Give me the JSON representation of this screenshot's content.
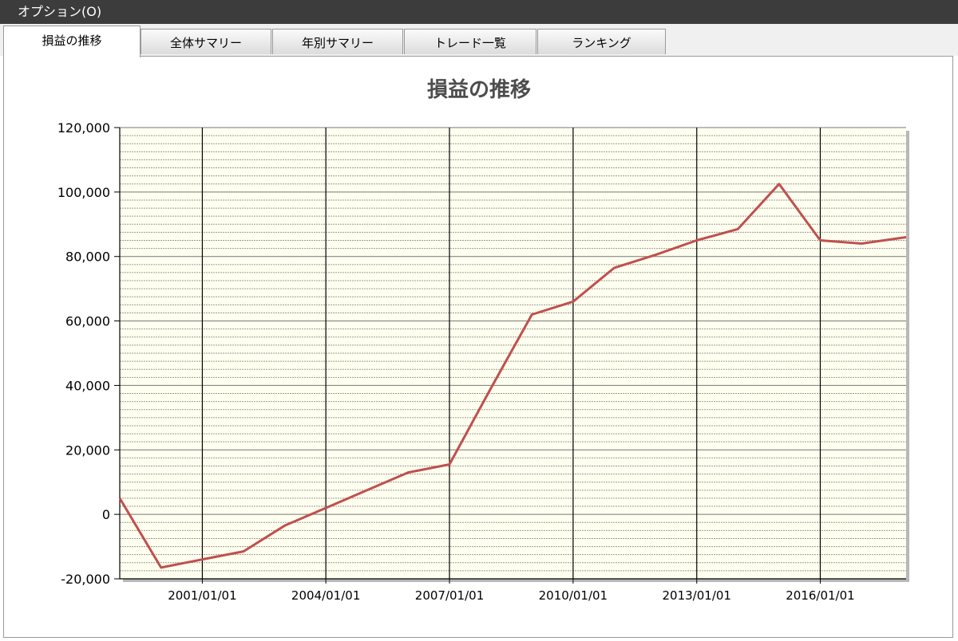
{
  "menu": {
    "options_label": "オプション(O)"
  },
  "tabs": [
    "損益の推移",
    "全体サマリー",
    "年別サマリー",
    "トレード一覧",
    "ランキング"
  ],
  "active_tab": 0,
  "colors": {
    "line": "#c0504d",
    "plot_bg": "#fffff0",
    "menubar": "#3c3c3c",
    "title": "#4d4d4d"
  },
  "chart_data": {
    "type": "line",
    "title": "損益の推移",
    "xlabel": "",
    "ylabel": "",
    "ylim": [
      -20000,
      120000
    ],
    "xlim": [
      "1998/12/31",
      "2018/01/31"
    ],
    "x_ticks": [
      "2001/01/01",
      "2004/01/01",
      "2007/01/01",
      "2010/01/01",
      "2013/01/01",
      "2016/01/01"
    ],
    "y_ticks": [
      "120,000",
      "100,000",
      "80,000",
      "60,000",
      "40,000",
      "20,000",
      "0",
      "-20,000"
    ],
    "y_tick_values": [
      120000,
      100000,
      80000,
      60000,
      40000,
      20000,
      0,
      -20000
    ],
    "grid": true,
    "series": [
      {
        "x": [
          "1998/12/31",
          "2000/01/01",
          "2001/01/01",
          "2002/01/01",
          "2003/01/01",
          "2004/01/01",
          "2005/01/01",
          "2006/01/01",
          "2007/01/01",
          "2008/01/01",
          "2009/01/01",
          "2010/01/01",
          "2011/01/01",
          "2012/01/01",
          "2013/01/01",
          "2014/01/01",
          "2015/01/01",
          "2016/01/01",
          "2017/01/01",
          "2018/01/31"
        ],
        "values": [
          5000,
          -16500,
          -14000,
          -11500,
          -3500,
          2000,
          7500,
          13000,
          15500,
          39000,
          62000,
          66000,
          76500,
          80500,
          85000,
          88500,
          102500,
          85000,
          84000,
          86000
        ]
      }
    ]
  }
}
